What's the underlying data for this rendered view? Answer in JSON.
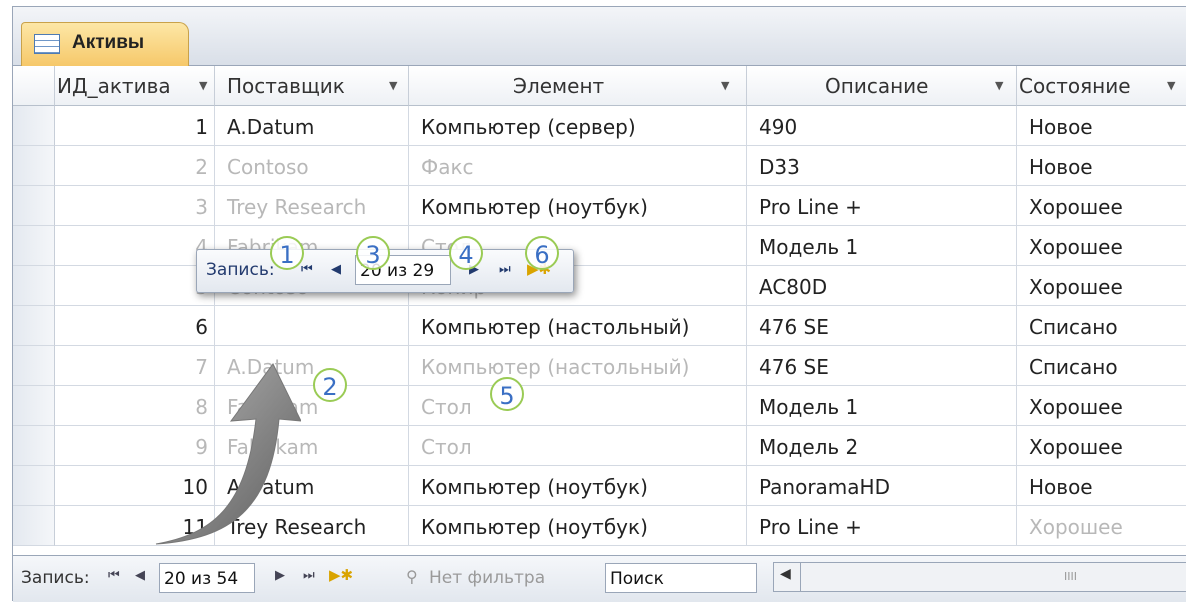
{
  "table_tab": {
    "label": "Активы",
    "icon": "table-icon"
  },
  "columns": [
    {
      "label": "ИД_актива"
    },
    {
      "label": "Поставщик"
    },
    {
      "label": "Элемент"
    },
    {
      "label": "Описание"
    },
    {
      "label": "Состояние"
    }
  ],
  "rows": [
    {
      "id": "1",
      "vendor": "A.Datum",
      "item": "Компьютер (сервер)",
      "desc": "490",
      "state": "Новое"
    },
    {
      "id": "2",
      "vendor": "Contoso",
      "item": "Факс",
      "desc": "D33",
      "state": "Новое"
    },
    {
      "id": "3",
      "vendor": "Trey Research",
      "item": "Компьютер (ноутбук)",
      "desc": "Pro Line +",
      "state": "Хорошее"
    },
    {
      "id": "4",
      "vendor": "Fabrikam",
      "item": "Стол",
      "desc": "Модель 1",
      "state": "Хорошее"
    },
    {
      "id": "5",
      "vendor": "Contoso",
      "item": "Копир",
      "desc": "AC80D",
      "state": "Хорошее"
    },
    {
      "id": "6",
      "vendor": "",
      "item": "Компьютер (настольный)",
      "desc": "476 SE",
      "state": "Списано"
    },
    {
      "id": "7",
      "vendor": "A.Datum",
      "item": "Компьютер (настольный)",
      "desc": "476 SE",
      "state": "Списано"
    },
    {
      "id": "8",
      "vendor": "Fabrikam",
      "item": "Стол",
      "desc": "Модель 1",
      "state": "Хорошее"
    },
    {
      "id": "9",
      "vendor": "Fabrikam",
      "item": "Стол",
      "desc": "Модель 2",
      "state": "Хорошее"
    },
    {
      "id": "10",
      "vendor": "A.Datum",
      "item": "Компьютер (ноутбук)",
      "desc": "PanoramaHD",
      "state": "Новое"
    },
    {
      "id": "11",
      "vendor": "Trey Research",
      "item": "Компьютер (ноутбук)",
      "desc": "Pro Line +",
      "state": "Хорошее"
    }
  ],
  "callout": {
    "record_label": "Запись:",
    "position_text": "20 из 29",
    "markers": [
      "1",
      "2",
      "3",
      "4",
      "5",
      "6"
    ]
  },
  "statusbar": {
    "record_label": "Запись:",
    "position_text": "20 из 54",
    "filter_label": "Нет фильтра",
    "search_value": "Поиск",
    "scroll_grip": "IIII"
  },
  "colors": {
    "accent_tab": "#f6c86a",
    "marker_border": "#9acb55",
    "marker_text": "#3a6fc4"
  }
}
